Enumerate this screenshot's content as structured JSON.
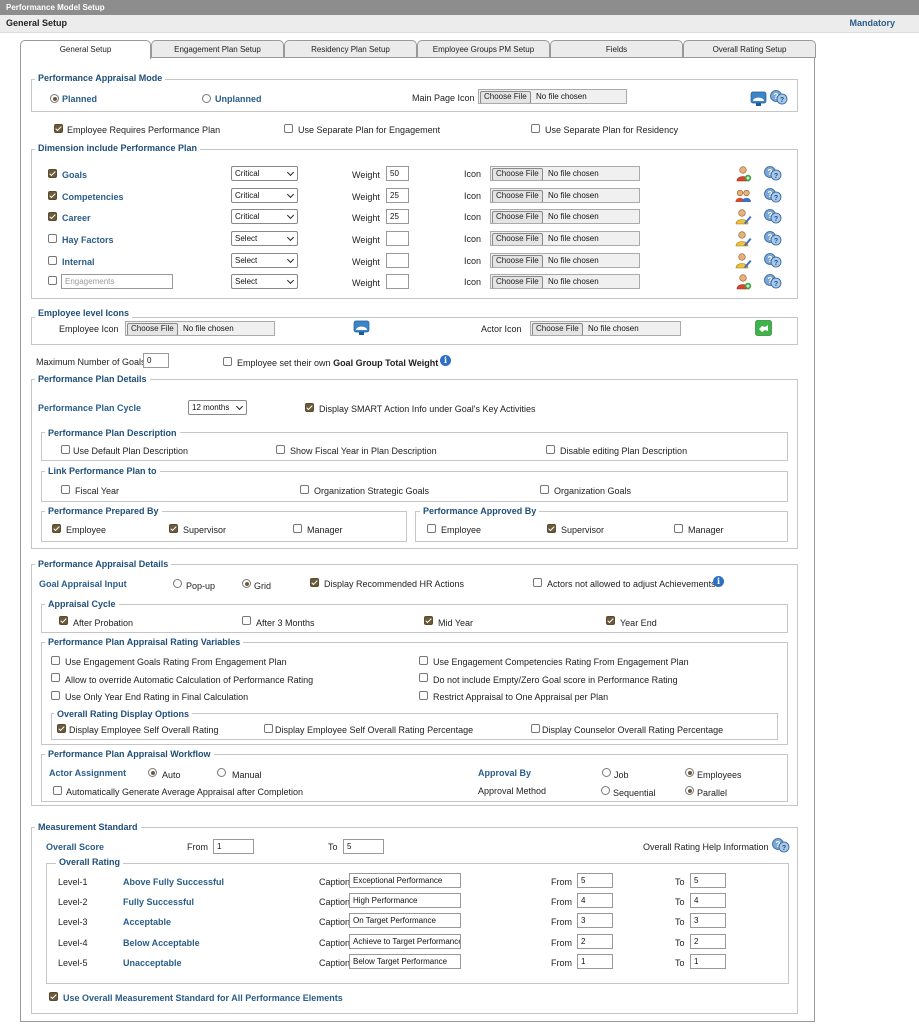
{
  "header": {
    "title": "Performance Model Setup",
    "subtitle": "General Setup",
    "mandatory": "Mandatory"
  },
  "tabs": [
    "General Setup",
    "Engagement Plan Setup",
    "Residency Plan Setup",
    "Employee Groups PM Setup",
    "Fields",
    "Overall Rating Setup"
  ],
  "appraisal_mode": {
    "legend": "Performance Appraisal Mode",
    "planned": "Planned",
    "unplanned": "Unplanned",
    "main_page_icon": "Main Page Icon",
    "choose_file": "Choose File",
    "no_file": "No file chosen",
    "emp_requires": "Employee Requires Performance Plan",
    "sep_engagement": "Use Separate Plan for Engagement",
    "sep_residency": "Use Separate Plan for Residency"
  },
  "dimension": {
    "legend": "Dimension include Performance Plan",
    "weight_label": "Weight",
    "icon_label": "Icon",
    "rows": [
      {
        "name": "Goals",
        "priority": "Critical",
        "weight": "50",
        "checked": true
      },
      {
        "name": "Competencies",
        "priority": "Critical",
        "weight": "25",
        "checked": true
      },
      {
        "name": "Career",
        "priority": "Critical",
        "weight": "25",
        "checked": true
      },
      {
        "name": "Hay Factors",
        "priority": "Select",
        "weight": "",
        "checked": false
      },
      {
        "name": "Internal",
        "priority": "Select",
        "weight": "",
        "checked": false
      },
      {
        "name": "Engagements",
        "priority": "Select",
        "weight": "",
        "checked": false
      }
    ]
  },
  "employee_icons": {
    "legend": "Employee level Icons",
    "employee_icon": "Employee Icon",
    "actor_icon": "Actor Icon"
  },
  "max_goals": {
    "label": "Maximum Number of Goals",
    "value": "0",
    "own_weight": "Employee set their own",
    "own_weight_bold": "Goal Group Total Weight"
  },
  "plan_details": {
    "legend": "Performance Plan Details",
    "cycle_label": "Performance Plan Cycle",
    "cycle_value": "12 months",
    "smart": "Display SMART Action Info under Goal's Key Activities",
    "desc_legend": "Performance Plan Description",
    "use_default": "Use Default Plan Description",
    "show_fiscal": "Show Fiscal Year in Plan Description",
    "disable_edit": "Disable editing Plan Description",
    "link_legend": "Link Performance Plan to",
    "fiscal_year": "Fiscal Year",
    "org_strategic": "Organization Strategic Goals",
    "org_goals": "Organization Goals",
    "prepared_legend": "Performance Prepared By",
    "approved_legend": "Performance Approved By",
    "employee": "Employee",
    "supervisor": "Supervisor",
    "manager": "Manager"
  },
  "appraisal_details": {
    "legend": "Performance Appraisal Details",
    "goal_input": "Goal Appraisal Input",
    "popup": "Pop-up",
    "grid": "Grid",
    "display_rec": "Display Recommended HR Actions",
    "actors_not_allowed": "Actors not allowed to adjust Achievements",
    "cycle_legend": "Appraisal Cycle",
    "after_probation": "After Probation",
    "after_3": "After 3 Months",
    "mid_year": "Mid Year",
    "year_end": "Year End",
    "vars_legend": "Performance Plan Appraisal Rating Variables",
    "v1": "Use Engagement Goals Rating From Engagement Plan",
    "v2": "Use Engagement Competencies Rating From Engagement Plan",
    "v3": "Allow to override Automatic Calculation of Performance Rating",
    "v4": "Do not include Empty/Zero Goal score in Performance Rating",
    "v5": "Use Only Year End Rating in Final Calculation",
    "v6": "Restrict Appraisal to One Appraisal per Plan",
    "overall_legend": "Overall Rating Display Options",
    "o1": "Display Employee Self Overall Rating",
    "o2": "Display Employee Self Overall Rating Percentage",
    "o3": "Display Counselor Overall Rating Percentage",
    "wf_legend": "Performance Plan Appraisal Workflow",
    "actor_assignment": "Actor Assignment",
    "auto": "Auto",
    "manual": "Manual",
    "approval_by": "Approval By",
    "job": "Job",
    "employees": "Employees",
    "approval_method": "Approval Method",
    "sequential": "Sequential",
    "parallel": "Parallel",
    "auto_gen": "Automatically Generate Average Appraisal after Completion"
  },
  "measurement": {
    "legend": "Measurement Standard",
    "overall_score": "Overall Score",
    "from": "From",
    "to": "To",
    "from_val": "1",
    "to_val": "5",
    "help_info": "Overall Rating Help Information",
    "rating_legend": "Overall Rating",
    "caption_label": "Caption",
    "levels": [
      {
        "level": "Level-1",
        "name": "Above Fully Successful",
        "caption": "Exceptional Performance",
        "from": "5",
        "to": "5"
      },
      {
        "level": "Level-2",
        "name": "Fully Successful",
        "caption": "High Performance",
        "from": "4",
        "to": "4"
      },
      {
        "level": "Level-3",
        "name": "Acceptable",
        "caption": "On Target Performance",
        "from": "3",
        "to": "3"
      },
      {
        "level": "Level-4",
        "name": "Below Acceptable",
        "caption": "Achieve to Target Performance",
        "from": "2",
        "to": "2"
      },
      {
        "level": "Level-5",
        "name": "Unacceptable",
        "caption": "Below Target Performance",
        "from": "1",
        "to": "1"
      }
    ],
    "use_overall": "Use Overall Measurement Standard for All Performance Elements"
  },
  "icons": {
    "help": "help-bubble-icon",
    "user_add": "user-add-icon",
    "users": "users-group-icon",
    "user_edit": "user-edit-icon",
    "monitor": "monitor-user-icon",
    "info": "info-icon"
  }
}
